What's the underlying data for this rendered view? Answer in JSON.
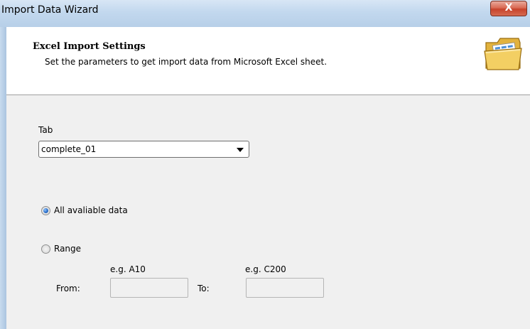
{
  "window": {
    "title": "Import Data Wizard",
    "close_label": "X"
  },
  "header": {
    "title": "Excel Import Settings",
    "subtitle": "Set the parameters to get import data from Microsoft Excel sheet.",
    "icon": "folder-icon"
  },
  "form": {
    "tab_label": "Tab",
    "tab_selected": "complete_01",
    "option_all_label": "All avaliable data",
    "option_all_selected": true,
    "option_range_label": "Range",
    "option_range_selected": false,
    "from_label": "From:",
    "from_hint": "e.g. A10",
    "from_value": "",
    "to_label": "To:",
    "to_hint": "e.g. C200",
    "to_value": ""
  }
}
